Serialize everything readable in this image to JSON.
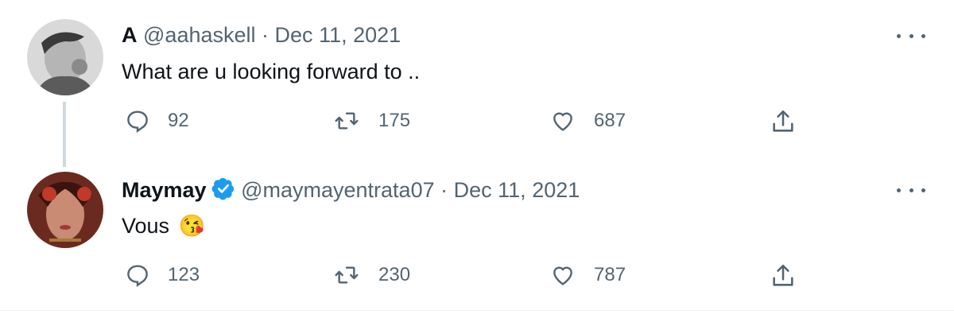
{
  "tweets": [
    {
      "name": "A",
      "handle": "@aahaskell",
      "sep": "·",
      "date": "Dec 11, 2021",
      "text": "What are u looking forward to ..",
      "reply_count": "92",
      "retweet_count": "175",
      "like_count": "687",
      "verified": false,
      "icons": [
        "reply-icon",
        "retweet-icon",
        "like-icon",
        "share-icon",
        "more-icon"
      ]
    },
    {
      "name": "Maymay",
      "handle": "@maymayentrata07",
      "sep": "·",
      "date": "Dec 11, 2021",
      "text": "Vous",
      "emoji": "😘",
      "reply_count": "123",
      "retweet_count": "230",
      "like_count": "787",
      "verified": true,
      "icons": [
        "reply-icon",
        "retweet-icon",
        "like-icon",
        "share-icon",
        "more-icon"
      ]
    }
  ],
  "colors": {
    "text": "#0f1419",
    "muted": "#536471",
    "verified": "#1d9bf0",
    "thread_line": "#cfd9de"
  }
}
